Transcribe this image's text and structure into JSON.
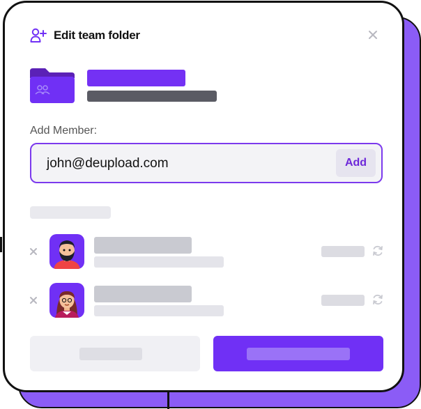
{
  "dialog": {
    "title": "Edit team folder",
    "add_member_label": "Add Member:",
    "add_member_input_value": "john@deupload.com",
    "add_button_label": "Add"
  },
  "colors": {
    "accent": "#7030f5",
    "shadow": "#8b5cf6",
    "input_border": "#7c3aed"
  },
  "icons": {
    "header": "add-user-icon",
    "close": "close-icon",
    "folder": "team-folder-icon",
    "remove": "remove-icon",
    "refresh": "refresh-icon"
  },
  "members": [
    {
      "avatar": "bearded-man-avatar"
    },
    {
      "avatar": "woman-avatar"
    }
  ]
}
